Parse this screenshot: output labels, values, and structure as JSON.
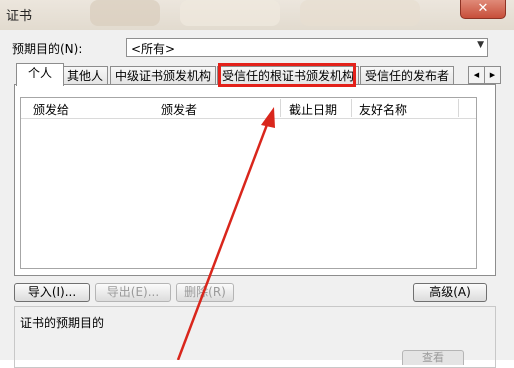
{
  "window": {
    "title": "证书",
    "close_glyph": "✕"
  },
  "purpose": {
    "label": "预期目的(N):",
    "selected": "<所有>"
  },
  "tabs": [
    {
      "label": "个人",
      "active": true
    },
    {
      "label": "其他人",
      "active": false
    },
    {
      "label": "中级证书颁发机构",
      "active": false
    },
    {
      "label": "受信任的根证书颁发机构",
      "active": false
    },
    {
      "label": "受信任的发布者",
      "active": false
    }
  ],
  "tab_scroll": {
    "left": "◀",
    "right": "▶"
  },
  "columns": [
    "颁发给",
    "颁发者",
    "截止日期",
    "友好名称"
  ],
  "buttons": {
    "import": "导入(I)...",
    "export": "导出(E)...",
    "remove": "删除(R)",
    "advanced": "高级(A)"
  },
  "purpose_group": {
    "label": "证书的预期目的",
    "change_button": "查看"
  },
  "annotation": {
    "highlight_color": "#e3211a",
    "arrow_color": "#d9261c"
  }
}
